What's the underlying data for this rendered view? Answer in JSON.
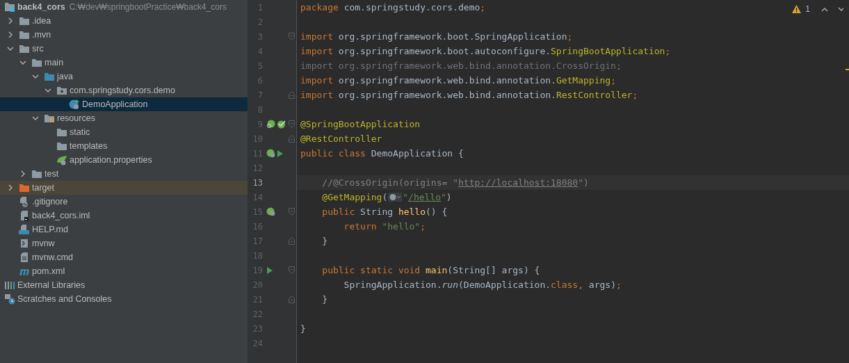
{
  "project_tree": [
    {
      "label": "back4_cors",
      "kind": "module",
      "path": "C:₩dev₩springbootPractice₩back4_cors",
      "selected": false,
      "children": [
        {
          "label": ".idea",
          "kind": "folder",
          "expanded": false,
          "selected": false
        },
        {
          "label": ".mvn",
          "kind": "folder",
          "expanded": false,
          "selected": false
        },
        {
          "label": "src",
          "kind": "folder",
          "expanded": true,
          "selected": false,
          "children": [
            {
              "label": "main",
              "kind": "folder",
              "expanded": true,
              "selected": false,
              "children": [
                {
                  "label": "java",
                  "kind": "source-folder",
                  "expanded": true,
                  "selected": false,
                  "children": [
                    {
                      "label": "com.springstudy.cors.demo",
                      "kind": "package",
                      "expanded": true,
                      "selected": false,
                      "children": [
                        {
                          "label": "DemoApplication",
                          "kind": "class",
                          "selected": true
                        }
                      ]
                    }
                  ]
                },
                {
                  "label": "resources",
                  "kind": "resource-folder",
                  "expanded": true,
                  "selected": false,
                  "children": [
                    {
                      "label": "static",
                      "kind": "folder",
                      "selected": false
                    },
                    {
                      "label": "templates",
                      "kind": "folder",
                      "selected": false
                    },
                    {
                      "label": "application.properties",
                      "kind": "spring-file",
                      "selected": false
                    }
                  ]
                }
              ]
            },
            {
              "label": "test",
              "kind": "folder",
              "expanded": false,
              "selected": false
            }
          ]
        },
        {
          "label": "target",
          "kind": "excluded-folder",
          "expanded": false,
          "selected": false
        },
        {
          "label": ".gitignore",
          "kind": "ignore-file",
          "selected": false
        },
        {
          "label": "back4_cors.iml",
          "kind": "iml-file",
          "selected": false
        },
        {
          "label": "HELP.md",
          "kind": "md-file",
          "selected": false
        },
        {
          "label": "mvnw",
          "kind": "shell-file",
          "selected": false
        },
        {
          "label": "mvnw.cmd",
          "kind": "text-file",
          "selected": false
        },
        {
          "label": "pom.xml",
          "kind": "maven-file",
          "selected": false
        }
      ]
    },
    {
      "label": "External Libraries",
      "kind": "libraries",
      "selected": false
    },
    {
      "label": "Scratches and Consoles",
      "kind": "scratches",
      "selected": false
    }
  ],
  "editor": {
    "warnings": "1",
    "lines": [
      {
        "number": "1",
        "current": false,
        "tokens": [
          {
            "text": "package ",
            "kind": "keyword"
          },
          {
            "text": "com.springstudy.cors.demo",
            "kind": "plain"
          },
          {
            "text": ";",
            "kind": "keyword"
          }
        ]
      },
      {
        "number": "2",
        "current": false
      },
      {
        "number": "3",
        "current": false,
        "fold_marker": {
          "kind": "start"
        },
        "tokens": [
          {
            "text": "import ",
            "kind": "keyword"
          },
          {
            "text": "org.springframework.boot.SpringApplication",
            "kind": "plain"
          },
          {
            "text": ";",
            "kind": "keyword"
          }
        ]
      },
      {
        "number": "4",
        "current": false,
        "tokens": [
          {
            "text": "import ",
            "kind": "keyword"
          },
          {
            "text": "org.springframework.boot.autoconfigure.",
            "kind": "plain"
          },
          {
            "text": "SpringBootApplication",
            "kind": "annotation"
          },
          {
            "text": ";",
            "kind": "keyword"
          }
        ]
      },
      {
        "number": "5",
        "current": false,
        "tokens": [
          {
            "text": "import org.springframework.web.bind.annotation.CrossOrigin;",
            "kind": "unused"
          }
        ]
      },
      {
        "number": "6",
        "current": false,
        "tokens": [
          {
            "text": "import ",
            "kind": "keyword"
          },
          {
            "text": "org.springframework.web.bind.annotation.",
            "kind": "plain"
          },
          {
            "text": "GetMapping",
            "kind": "annotation"
          },
          {
            "text": ";",
            "kind": "keyword"
          }
        ]
      },
      {
        "number": "7",
        "current": false,
        "fold_marker": {
          "kind": "end"
        },
        "tokens": [
          {
            "text": "import ",
            "kind": "keyword"
          },
          {
            "text": "org.springframework.web.bind.annotation.",
            "kind": "plain"
          },
          {
            "text": "RestController",
            "kind": "annotation"
          },
          {
            "text": ";",
            "kind": "keyword"
          }
        ]
      },
      {
        "number": "8",
        "current": false
      },
      {
        "number": "9",
        "current": false,
        "fold_marker": {
          "kind": "start"
        },
        "gutter_icons": [
          {
            "kind": "bean-search"
          },
          {
            "kind": "bean-check"
          }
        ],
        "tokens": [
          {
            "text": "@SpringBootApplication",
            "kind": "annotation"
          }
        ]
      },
      {
        "number": "10",
        "current": false,
        "fold_marker": {
          "kind": "end"
        },
        "tokens": [
          {
            "text": "@RestController",
            "kind": "annotation"
          }
        ]
      },
      {
        "number": "11",
        "current": false,
        "gutter_icons": [
          {
            "kind": "bean-web"
          },
          {
            "kind": "run"
          }
        ],
        "tokens": [
          {
            "text": "public class ",
            "kind": "keyword"
          },
          {
            "text": "DemoApplication {",
            "kind": "plain"
          }
        ]
      },
      {
        "number": "12",
        "current": false
      },
      {
        "number": "13",
        "current": true,
        "tokens": [
          {
            "text": "    //@CrossOrigin(origins= \"",
            "kind": "comment"
          },
          {
            "text": "http://localhost:18080",
            "kind": "comment-link"
          },
          {
            "text": "\")",
            "kind": "comment"
          }
        ]
      },
      {
        "number": "14",
        "current": false,
        "tokens": [
          {
            "text": "    @GetMapping",
            "kind": "annotation"
          },
          {
            "text": "(",
            "kind": "plain"
          },
          {
            "kind": "globe-inlay"
          },
          {
            "text": "\"",
            "kind": "string"
          },
          {
            "text": "/hello",
            "kind": "string-link"
          },
          {
            "text": "\"",
            "kind": "string"
          },
          {
            "text": ")",
            "kind": "plain"
          }
        ]
      },
      {
        "number": "15",
        "current": false,
        "fold_marker": {
          "kind": "start"
        },
        "gutter_icons": [
          {
            "kind": "bean-web"
          }
        ],
        "tokens": [
          {
            "text": "    public ",
            "kind": "keyword"
          },
          {
            "text": "String ",
            "kind": "plain"
          },
          {
            "text": "hello",
            "kind": "method"
          },
          {
            "text": "() {",
            "kind": "plain"
          }
        ]
      },
      {
        "number": "16",
        "current": false,
        "tokens": [
          {
            "text": "        return ",
            "kind": "keyword"
          },
          {
            "text": "\"hello\"",
            "kind": "string"
          },
          {
            "text": ";",
            "kind": "keyword"
          }
        ]
      },
      {
        "number": "17",
        "current": false,
        "fold_marker": {
          "kind": "end"
        },
        "tokens": [
          {
            "text": "    }",
            "kind": "plain"
          }
        ]
      },
      {
        "number": "18",
        "current": false
      },
      {
        "number": "19",
        "current": false,
        "fold_marker": {
          "kind": "start"
        },
        "gutter_icons": [
          {
            "kind": "run"
          }
        ],
        "tokens": [
          {
            "text": "    public static void ",
            "kind": "keyword"
          },
          {
            "text": "main",
            "kind": "method"
          },
          {
            "text": "(String[] args) {",
            "kind": "plain"
          }
        ]
      },
      {
        "number": "20",
        "current": false,
        "tokens": [
          {
            "text": "        SpringApplication.",
            "kind": "plain"
          },
          {
            "text": "run",
            "kind": "static-call"
          },
          {
            "text": "(DemoApplication.",
            "kind": "plain"
          },
          {
            "text": "class, ",
            "kind": "keyword"
          },
          {
            "text": "args)",
            "kind": "plain"
          },
          {
            "text": ";",
            "kind": "keyword"
          }
        ]
      },
      {
        "number": "21",
        "current": false,
        "fold_marker": {
          "kind": "end"
        },
        "tokens": [
          {
            "text": "    }",
            "kind": "plain"
          }
        ]
      },
      {
        "number": "22",
        "current": false
      },
      {
        "number": "23",
        "current": false,
        "tokens": [
          {
            "text": "}",
            "kind": "plain"
          }
        ]
      },
      {
        "number": "24",
        "current": false
      }
    ]
  }
}
